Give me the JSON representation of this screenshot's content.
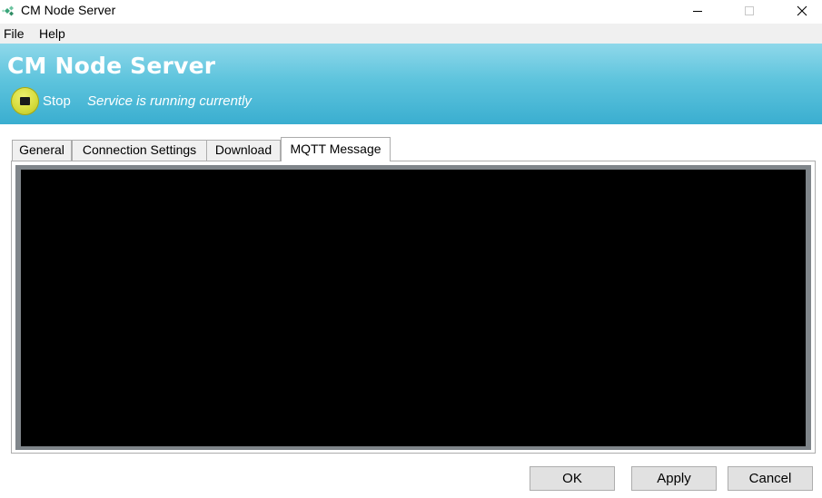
{
  "window": {
    "title": "CM Node Server"
  },
  "menu": {
    "items": [
      {
        "label": "File"
      },
      {
        "label": "Help"
      }
    ]
  },
  "header": {
    "title": "CM Node Server",
    "stop_label": "Stop",
    "status_text": "Service is running currently"
  },
  "tabs": [
    {
      "label": "General",
      "active": false
    },
    {
      "label": "Connection Settings",
      "active": false
    },
    {
      "label": "Download",
      "active": false
    },
    {
      "label": "MQTT Message",
      "active": true
    }
  ],
  "console": {
    "content": ""
  },
  "buttons": {
    "ok": "OK",
    "apply": "Apply",
    "cancel": "Cancel"
  },
  "colors": {
    "header_top": "#8fd8ea",
    "header_bottom": "#3aaed0",
    "stop_button": "#d5dc3c",
    "console_background": "#000000",
    "console_border": "#7f858a"
  },
  "icons": {
    "app": "app-diamond-icon",
    "stop": "stop-icon",
    "minimize": "minimize-icon",
    "maximize": "maximize-icon",
    "close": "close-icon"
  }
}
